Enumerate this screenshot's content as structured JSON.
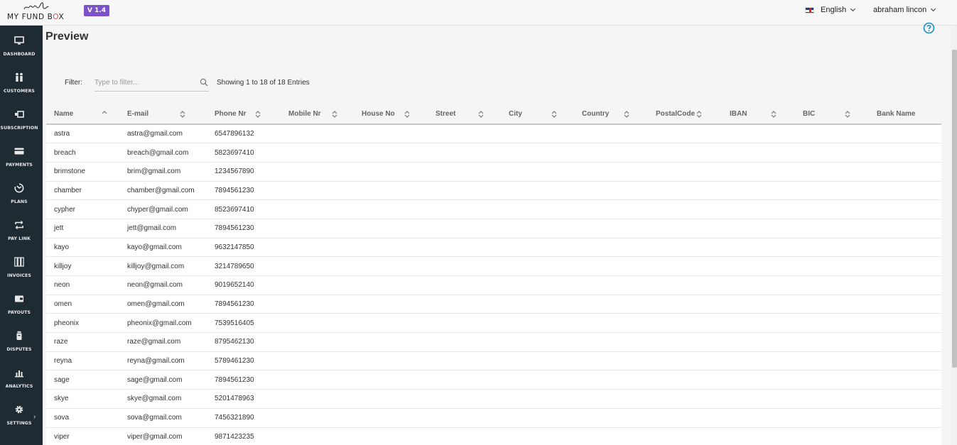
{
  "header": {
    "logo_text": "MY FUND B",
    "logo_o": "O",
    "logo_x": "X",
    "version": "V 1.4",
    "language": "English",
    "user": "abraham lincon"
  },
  "sidebar": {
    "items": [
      {
        "label": "DASHBOARD",
        "icon": "monitor-icon"
      },
      {
        "label": "CUSTOMERS",
        "icon": "people-icon"
      },
      {
        "label": "SUBSCRIPTION",
        "icon": "subscription-icon"
      },
      {
        "label": "PAYMENTS",
        "icon": "card-icon"
      },
      {
        "label": "PLANS",
        "icon": "plans-icon"
      },
      {
        "label": "PAY LINK",
        "icon": "repeat-icon"
      },
      {
        "label": "INVOICES",
        "icon": "invoices-icon"
      },
      {
        "label": "PAYOUTS",
        "icon": "wallet-icon"
      },
      {
        "label": "DISPUTES",
        "icon": "jar-icon"
      },
      {
        "label": "ANALYTICS",
        "icon": "bar-chart-icon"
      },
      {
        "label": "SETTINGS",
        "icon": "gear-icon"
      }
    ],
    "expand_glyph": "›"
  },
  "main": {
    "title": "Preview",
    "filter_label": "Filter:",
    "filter_placeholder": "Type to filter...",
    "entries_text": "Showing 1 to 18 of 18 Entries"
  },
  "table": {
    "columns": [
      "Name",
      "E-mail",
      "Phone Nr",
      "Mobile Nr",
      "House No",
      "Street",
      "City",
      "Country",
      "PostalCode",
      "IBAN",
      "BIC",
      "Bank Name"
    ],
    "rows": [
      [
        "astra",
        "astra@gmail.com",
        "6547896132"
      ],
      [
        "breach",
        "breach@gmail.com",
        "5823697410"
      ],
      [
        "brimstone",
        "brim@gmail.com",
        "1234567890"
      ],
      [
        "chamber",
        "chamber@gmail.com",
        "7894561230"
      ],
      [
        "cypher",
        "chyper@gmail.com",
        "8523697410"
      ],
      [
        "jett",
        "jett@gmail.com",
        "7894561230"
      ],
      [
        "kayo",
        "kayo@gmail.com",
        "9632147850"
      ],
      [
        "killjoy",
        "killjoy@gmail.com",
        "3214789650"
      ],
      [
        "neon",
        "neon@gmail.com",
        "9019652140"
      ],
      [
        "omen",
        "omen@gmail.com",
        "7894561230"
      ],
      [
        "pheonix",
        "pheonix@gmail.com",
        "7539516405"
      ],
      [
        "raze",
        "raze@gmail.com",
        "8795462130"
      ],
      [
        "reyna",
        "reyna@gmail.com",
        "5789461230"
      ],
      [
        "sage",
        "sage@gmail.com",
        "7894561230"
      ],
      [
        "skye",
        "skye@gmail.com",
        "5201478963"
      ],
      [
        "sova",
        "sova@gmail.com",
        "7456321890"
      ],
      [
        "viper",
        "viper@gmail.com",
        "9871423235"
      ]
    ]
  },
  "colors": {
    "sidebar_bg": "#1e2b33",
    "version_badge": "#7b52c8",
    "help_icon": "#1a8fc7"
  }
}
